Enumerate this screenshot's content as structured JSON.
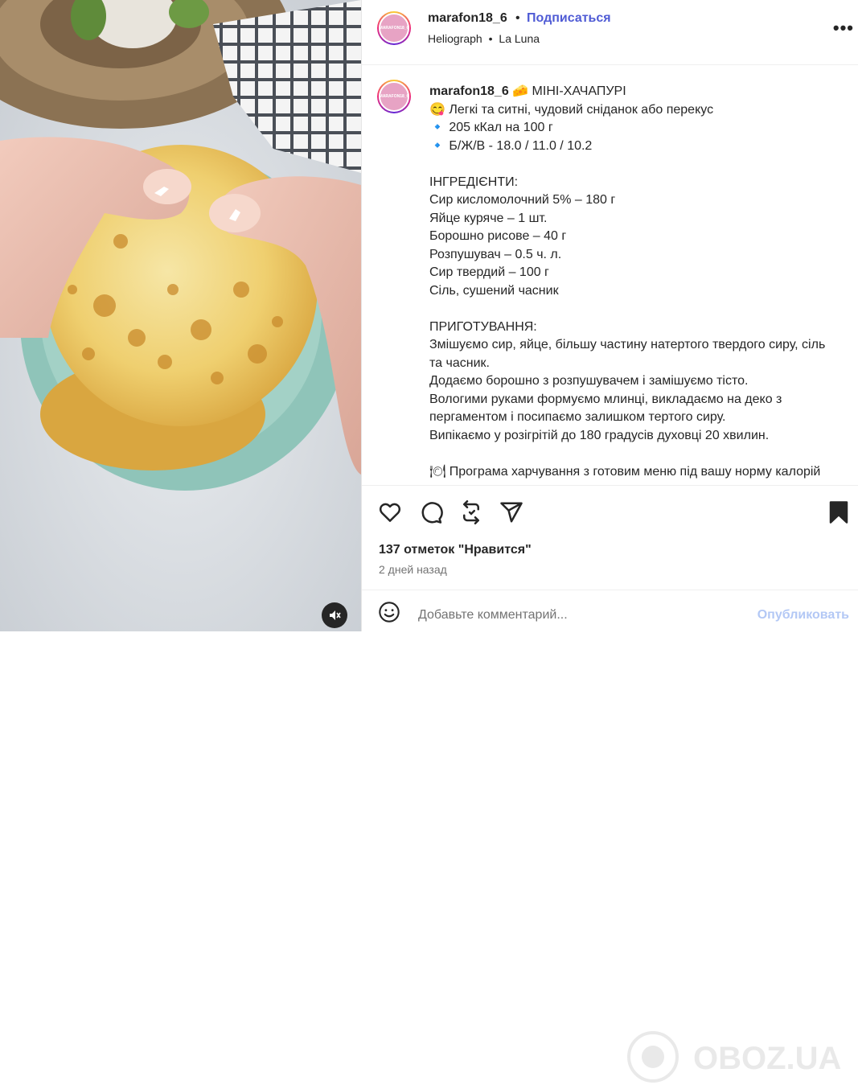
{
  "post": {
    "username": "marafon18_6",
    "avatar_text": "MARAFON18_6",
    "follow_label": "Подписаться",
    "separator": "•",
    "location_primary": "Heliograph",
    "location_separator": "•",
    "location_secondary": "La Luna",
    "more_label": "•••"
  },
  "caption": {
    "username": "marafon18_6",
    "lines": [
      "🧀 МІНІ-ХАЧАПУРІ",
      "😋 Легкі та ситні, чудовий сніданок або перекус",
      "🔹 205 кКал на 100 г",
      "🔹 Б/Ж/В - 18.0 / 11.0 / 10.2",
      "",
      "ІНГРЕДІЄНТИ:",
      "Сир кисломолочний 5% – 180 г",
      "Яйце куряче – 1 шт.",
      "Борошно рисове – 40 г",
      "Розпушувач – 0.5 ч. л.",
      "Сир твердий – 100 г",
      "Сіль, сушений часник",
      "",
      "ПРИГОТУВАННЯ:",
      "Змішуємо сир, яйце, більшу частину натертого твердого сиру, сіль та часник.",
      "Додаємо борошно з розпушувачем і замішуємо тісто.",
      "Вологими руками формуємо млинці, викладаємо на деко з пергаментом і посипаємо залишком тертого сиру.",
      "Випікаємо у розігрітій до 180 градусів духовці 20 хвилин.",
      "",
      "🍽 Програма харчування з готовим меню під вашу норму калорій"
    ]
  },
  "actions": {
    "like_icon": "heart-icon",
    "comment_icon": "comment-icon",
    "repost_icon": "repost-icon",
    "share_icon": "send-icon",
    "save_icon": "bookmark-icon"
  },
  "likes": "137 отметок \"Нравится\"",
  "date": "2 дней назад",
  "comment": {
    "placeholder": "Добавьте комментарий...",
    "publish_label": "Опубликовать"
  },
  "watermark": "OBOZ.UA",
  "colors": {
    "accent": "#4f5bd5",
    "publish_disabled": "#b3c8f5",
    "secondary_text": "#737373"
  }
}
